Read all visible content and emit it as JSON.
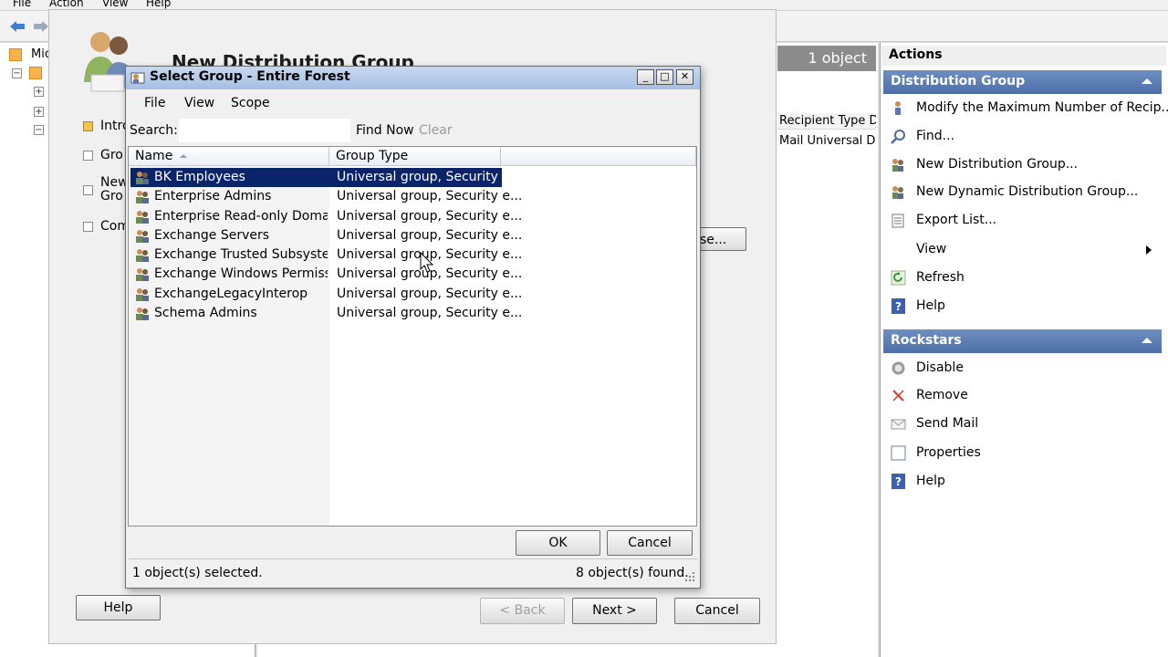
{
  "mmc": {
    "menu": [
      "File",
      "Action",
      "View",
      "Help"
    ],
    "tree_top_label": "Mic",
    "center_header": "1 object",
    "center_column": "Recipient Type De",
    "center_row": "Mail Universal Dis"
  },
  "actions_pane": {
    "title": "Actions",
    "groups": [
      {
        "title": "Distribution Group",
        "items": [
          {
            "label": "Modify the Maximum Number of Recip...",
            "icon": "person-edit-icon"
          },
          {
            "label": "Find...",
            "icon": "find-icon"
          },
          {
            "label": "New Distribution Group...",
            "icon": "new-group-icon"
          },
          {
            "label": "New Dynamic Distribution Group...",
            "icon": "new-dynamic-group-icon"
          },
          {
            "label": "Export List...",
            "icon": "export-list-icon"
          },
          {
            "label": "View",
            "icon": "none",
            "submenu": true
          },
          {
            "label": "Refresh",
            "icon": "refresh-icon"
          },
          {
            "label": "Help",
            "icon": "help-icon"
          }
        ]
      },
      {
        "title": "Rockstars",
        "items": [
          {
            "label": "Disable",
            "icon": "disable-icon"
          },
          {
            "label": "Remove",
            "icon": "remove-icon"
          },
          {
            "label": "Send Mail",
            "icon": "mail-icon"
          },
          {
            "label": "Properties",
            "icon": "properties-icon"
          },
          {
            "label": "Help",
            "icon": "help-icon"
          }
        ]
      }
    ]
  },
  "wizard": {
    "title": "New Distribution Group",
    "nav": [
      "Intro",
      "Gro",
      "New\nGro",
      "Com"
    ],
    "browse_button": "se...",
    "help_button": "Help",
    "back_button": "< Back",
    "next_button": "Next >",
    "cancel_button": "Cancel"
  },
  "dialog": {
    "title": "Select Group - Entire Forest",
    "menu": [
      "File",
      "View",
      "Scope"
    ],
    "search_label": "Search:",
    "search_value": "",
    "find_now": "Find Now",
    "clear": "Clear",
    "columns": [
      "Name",
      "Group Type"
    ],
    "rows": [
      {
        "name": "BK Employees",
        "type": "Universal group, Security e...",
        "selected": true
      },
      {
        "name": "Enterprise Admins",
        "type": "Universal group, Security e..."
      },
      {
        "name": "Enterprise Read-only Domain ...",
        "type": "Universal group, Security e..."
      },
      {
        "name": "Exchange Servers",
        "type": "Universal group, Security e..."
      },
      {
        "name": "Exchange Trusted Subsystem",
        "type": "Universal group, Security e..."
      },
      {
        "name": "Exchange Windows Permissio...",
        "type": "Universal group, Security e..."
      },
      {
        "name": "ExchangeLegacyInterop",
        "type": "Universal group, Security e..."
      },
      {
        "name": "Schema Admins",
        "type": "Universal group, Security e..."
      }
    ],
    "ok_button": "OK",
    "cancel_button": "Cancel",
    "status_selected": "1 object(s) selected.",
    "status_found": "8 object(s) found.",
    "window_controls": {
      "minimize": "_",
      "maximize": "□",
      "close": "✕"
    }
  }
}
